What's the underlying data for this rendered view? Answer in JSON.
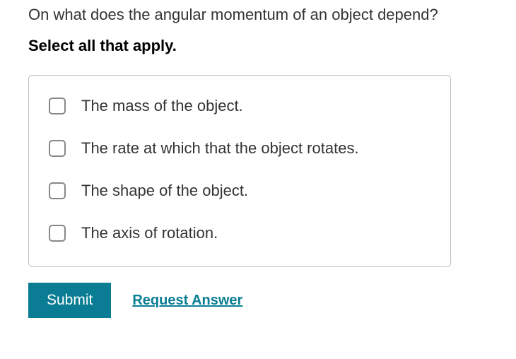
{
  "question": "On what does the angular momentum of an object depend?",
  "instruction": "Select all that apply.",
  "options": [
    {
      "label": "The mass of the object."
    },
    {
      "label": "The rate at which that the object rotates."
    },
    {
      "label": "The shape of the object."
    },
    {
      "label": "The axis of rotation."
    }
  ],
  "actions": {
    "submit_label": "Submit",
    "request_label": "Request Answer"
  }
}
